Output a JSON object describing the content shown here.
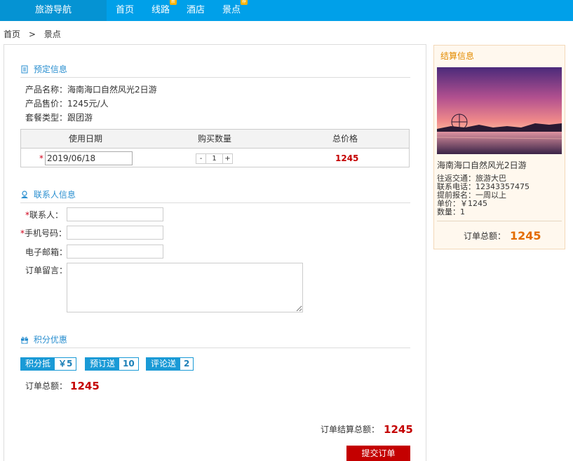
{
  "nav": {
    "brand": "旅游导航",
    "items": [
      {
        "label": "首页",
        "badge": ""
      },
      {
        "label": "线路",
        "badge": "新"
      },
      {
        "label": "酒店",
        "badge": ""
      },
      {
        "label": "景点",
        "badge": "荐"
      }
    ]
  },
  "breadcrumb": [
    "首页",
    ">",
    "景点"
  ],
  "booking": {
    "title": "预定信息",
    "product_name": "产品名称：海南海口自然风光2日游",
    "product_price": "产品售价：1245元/人",
    "package_type": "套餐类型：跟团游",
    "table": {
      "headers": [
        "使用日期",
        "购买数量",
        "总价格"
      ],
      "date": "2019/06/18",
      "minus": "-",
      "qty": "1",
      "plus": "+",
      "total": "1245",
      "required_mark": "*"
    }
  },
  "contact": {
    "title": "联系人信息",
    "required_mark": "*",
    "fields": {
      "name": "联系人：",
      "phone": "手机号码：",
      "email": "电子邮箱：",
      "note": "订单留言："
    }
  },
  "points": {
    "title": "积分优惠",
    "tags": [
      {
        "key": "积分抵",
        "value": "￥5"
      },
      {
        "key": "预订送",
        "value": "10"
      },
      {
        "key": "评论送",
        "value": "2"
      }
    ],
    "order_total_label": "订单总额：",
    "order_total": "1245"
  },
  "settle": {
    "label": "订单结算总额：",
    "value": "1245",
    "submit": "提交订单"
  },
  "side": {
    "title": "结算信息",
    "product": "海南海口自然风光2日游",
    "lines": [
      "往返交通：旅游大巴",
      "联系电话：12343357475",
      "提前报名：一周以上",
      "单价：￥1245",
      "数量：1"
    ],
    "total_label": "订单总额：",
    "total": "1245"
  },
  "colors": {
    "nav": "#00a0e9",
    "accent": "#2a8fd0",
    "price": "#c40000",
    "side_total": "#e36c00"
  }
}
